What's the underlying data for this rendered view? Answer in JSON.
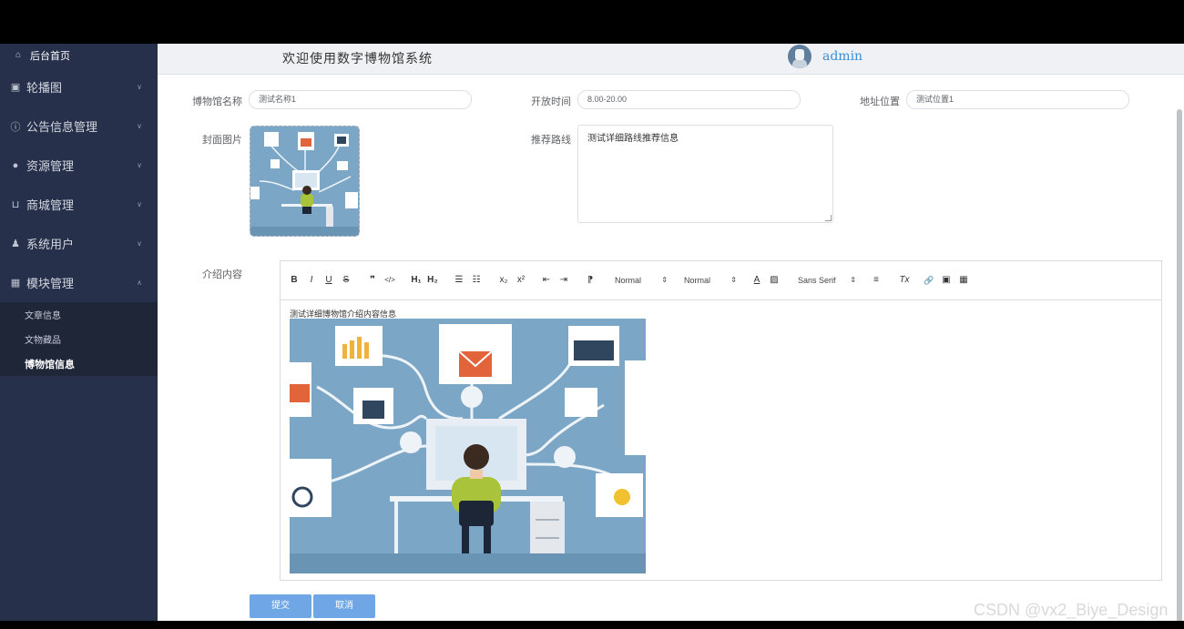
{
  "sidebar": {
    "home_label": "后台首页",
    "items": [
      {
        "label": "轮播图"
      },
      {
        "label": "公告信息管理"
      },
      {
        "label": "资源管理"
      },
      {
        "label": "商城管理"
      },
      {
        "label": "系统用户"
      },
      {
        "label": "模块管理"
      }
    ],
    "sub_items": [
      {
        "label": "文章信息"
      },
      {
        "label": "文物藏品"
      },
      {
        "label": "博物馆信息"
      }
    ]
  },
  "header": {
    "title": "欢迎使用数字博物馆系统",
    "username": "admin"
  },
  "form": {
    "name_label": "博物馆名称",
    "name_value": "测试名称1",
    "hours_label": "开放时间",
    "hours_value": "8.00-20.00",
    "address_label": "地址位置",
    "address_value": "测试位置1",
    "cover_label": "封面图片",
    "route_label": "推荐路线",
    "route_value": "测试详细路线推荐信息",
    "intro_label": "介绍内容",
    "intro_text": "测试详细博物馆介绍内容信息"
  },
  "toolbar": {
    "bold": "B",
    "italic": "I",
    "underline": "U",
    "strike": "S",
    "quote": "❞",
    "code": "</>",
    "h1": "H₁",
    "h2": "H₂",
    "ordered_list": "☰",
    "bullet_list": "☷",
    "subscript": "x₂",
    "superscript": "x²",
    "outdent": "⇤",
    "indent": "⇥",
    "direction": "⁋",
    "size_select": "Normal",
    "header_select": "Normal",
    "color": "A",
    "background": "▨",
    "font_select": "Sans Serif",
    "align": "≡",
    "clean": "Tx",
    "link": "🔗",
    "image": "▣",
    "video": "▦"
  },
  "buttons": {
    "submit": "提交",
    "cancel": "取消"
  },
  "watermark": "CSDN @vx2_Biye_Design"
}
